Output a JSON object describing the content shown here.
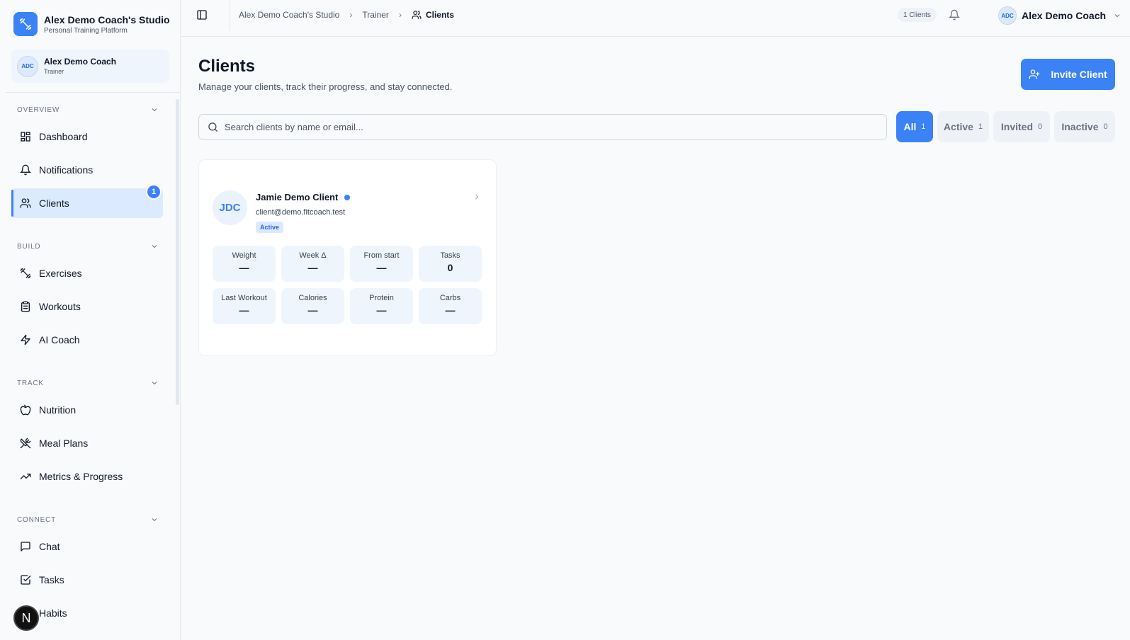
{
  "brand": {
    "title": "Alex Demo Coach's Studio",
    "subtitle": "Personal Training Platform"
  },
  "user": {
    "initials": "ADC",
    "name": "Alex Demo Coach",
    "role": "Trainer"
  },
  "sidebar": {
    "sections": [
      {
        "label": "OVERVIEW",
        "items": [
          {
            "label": "Dashboard",
            "icon": "dashboard-icon"
          },
          {
            "label": "Notifications",
            "icon": "bell-icon"
          },
          {
            "label": "Clients",
            "icon": "users-icon",
            "active": true,
            "badge": "1"
          }
        ]
      },
      {
        "label": "BUILD",
        "items": [
          {
            "label": "Exercises",
            "icon": "dumbbell-icon"
          },
          {
            "label": "Workouts",
            "icon": "clipboard-icon"
          },
          {
            "label": "AI Coach",
            "icon": "bolt-icon"
          }
        ]
      },
      {
        "label": "TRACK",
        "items": [
          {
            "label": "Nutrition",
            "icon": "apple-icon"
          },
          {
            "label": "Meal Plans",
            "icon": "utensils-icon"
          },
          {
            "label": "Metrics & Progress",
            "icon": "trending-up-icon"
          }
        ]
      },
      {
        "label": "CONNECT",
        "items": [
          {
            "label": "Chat",
            "icon": "message-icon"
          },
          {
            "label": "Tasks",
            "icon": "checkbox-icon"
          },
          {
            "label": "Habits",
            "icon": "habit-icon"
          }
        ]
      }
    ],
    "next_badge": "N"
  },
  "topbar": {
    "breadcrumbs": [
      "Alex Demo Coach's Studio",
      "Trainer",
      "Clients"
    ],
    "client_count": "1 Clients",
    "user_initials": "ADC",
    "user_name": "Alex Demo Coach"
  },
  "main": {
    "title": "Clients",
    "subtitle": "Manage your clients, track their progress, and stay connected.",
    "invite_label": "Invite Client",
    "search_placeholder": "Search clients by name or email...",
    "filters": [
      {
        "label": "All",
        "count": "1",
        "active": true
      },
      {
        "label": "Active",
        "count": "1"
      },
      {
        "label": "Invited",
        "count": "0"
      },
      {
        "label": "Inactive",
        "count": "0"
      }
    ],
    "client": {
      "initials": "JDC",
      "name": "Jamie Demo Client",
      "email": "client@demo.fitcoach.test",
      "status": "Active",
      "stats": [
        {
          "label": "Weight",
          "value": "—"
        },
        {
          "label": "Week Δ",
          "value": "—"
        },
        {
          "label": "From start",
          "value": "—"
        },
        {
          "label": "Tasks",
          "value": "0"
        },
        {
          "label": "Last Workout",
          "value": "—"
        },
        {
          "label": "Calories",
          "value": "—"
        },
        {
          "label": "Protein",
          "value": "—"
        },
        {
          "label": "Carbs",
          "value": "—"
        }
      ]
    }
  },
  "colors": {
    "accent": "#3b82f6",
    "background": "#f8fafc",
    "card": "#ffffff",
    "tile": "#eef5fc"
  }
}
